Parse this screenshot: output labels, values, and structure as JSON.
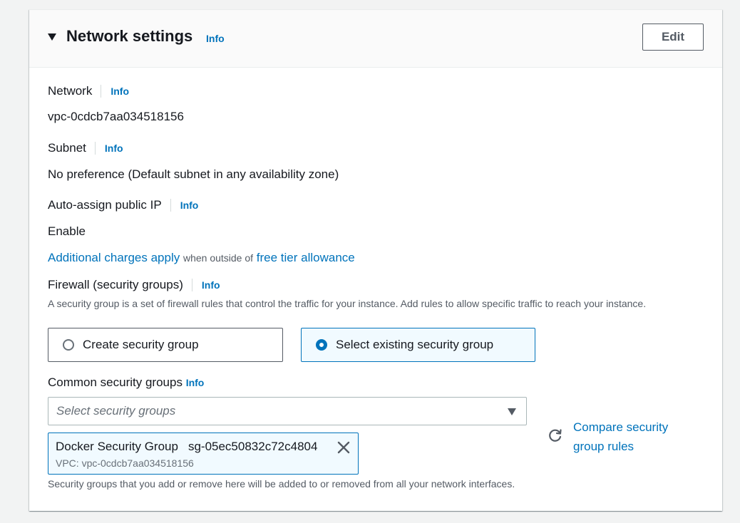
{
  "header": {
    "title": "Network settings",
    "info": "Info",
    "edit_label": "Edit"
  },
  "network": {
    "label": "Network",
    "info": "Info",
    "value": "vpc-0cdcb7aa034518156"
  },
  "subnet": {
    "label": "Subnet",
    "info": "Info",
    "value": "No preference (Default subnet in any availability zone)"
  },
  "auto_ip": {
    "label": "Auto-assign public IP",
    "info": "Info",
    "value": "Enable"
  },
  "charges": {
    "link1": "Additional charges apply",
    "middle": "when outside of",
    "link2": "free tier allowance"
  },
  "firewall": {
    "label": "Firewall (security groups)",
    "info": "Info",
    "description": "A security group is a set of firewall rules that control the traffic for your instance. Add rules to allow specific traffic to reach your instance.",
    "options": [
      {
        "label": "Create security group",
        "selected": false
      },
      {
        "label": "Select existing security group",
        "selected": true
      }
    ]
  },
  "common": {
    "label": "Common security groups",
    "info": "Info",
    "placeholder": "Select security groups",
    "selected": {
      "name": "Docker Security Group",
      "id": "sg-05ec50832c72c4804",
      "vpc": "VPC: vpc-0cdcb7aa034518156"
    },
    "compare_link": "Compare security group rules",
    "footer": "Security groups that you add or remove here will be added to or removed from all your network interfaces."
  },
  "colors": {
    "link": "#0073bb",
    "selected_bg": "#f1faff",
    "text": "#16191f"
  }
}
